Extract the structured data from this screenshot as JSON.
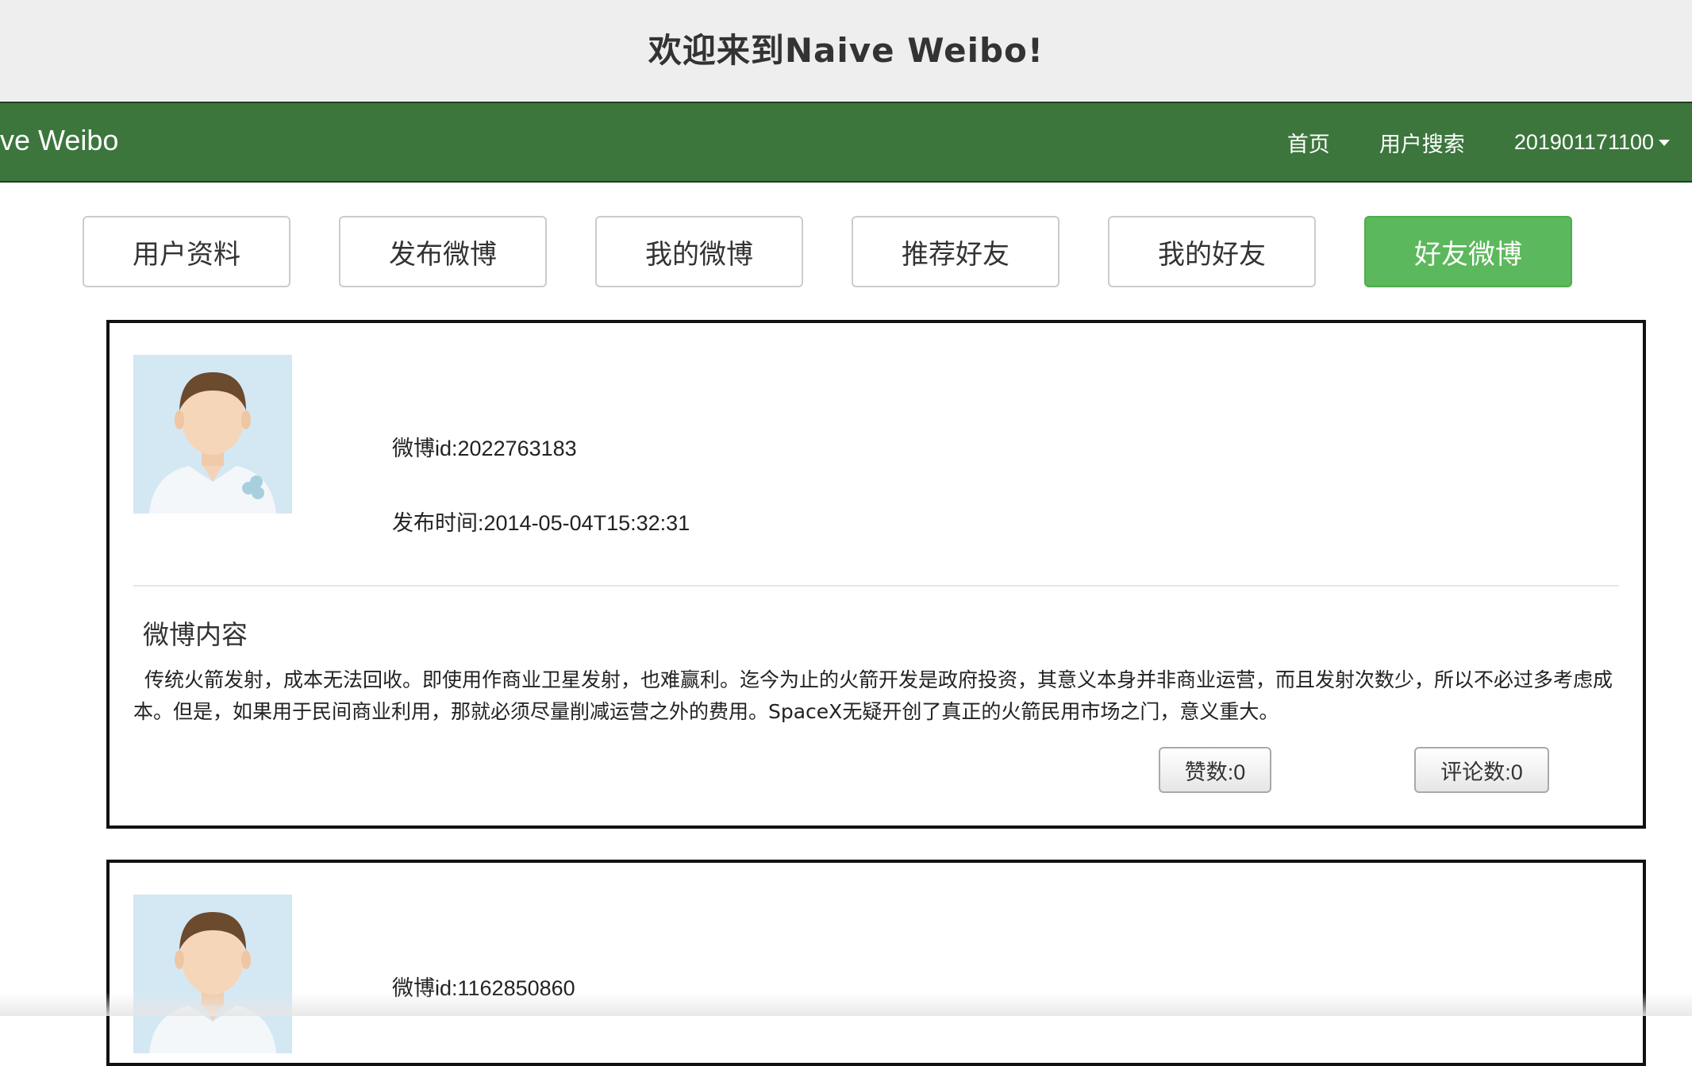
{
  "header": {
    "title": "欢迎来到Naive Weibo!"
  },
  "navbar": {
    "brand": "ive Weibo",
    "links": [
      "首页",
      "用户搜索"
    ],
    "user_menu": "201901171100"
  },
  "tabs": [
    {
      "label": "用户资料",
      "active": false
    },
    {
      "label": "发布微博",
      "active": false
    },
    {
      "label": "我的微博",
      "active": false
    },
    {
      "label": "推荐好友",
      "active": false
    },
    {
      "label": "我的好友",
      "active": false
    },
    {
      "label": "好友微博",
      "active": true
    }
  ],
  "posts": [
    {
      "id_text": "微博id:2022763183",
      "time_text": "发布时间:2014-05-04T15:32:31",
      "content_title": "微博内容",
      "content": "传统火箭发射，成本无法回收。即使用作商业卫星发射，也难赢利。迄今为止的火箭开发是政府投资，其意义本身并非商业运营，而且发射次数少，所以不必过多考虑成本。但是，如果用于民间商业利用，那就必须尽量削减运营之外的费用。SpaceX无疑开创了真正的火箭民用市场之门，意义重大。",
      "likes": "赞数:0",
      "comments": "评论数:0"
    },
    {
      "id_text": "微博id:1162850860"
    }
  ],
  "colors": {
    "navbar": "#3c763d",
    "active_tab": "#5cb85c",
    "header_bg": "#eeeeee"
  }
}
